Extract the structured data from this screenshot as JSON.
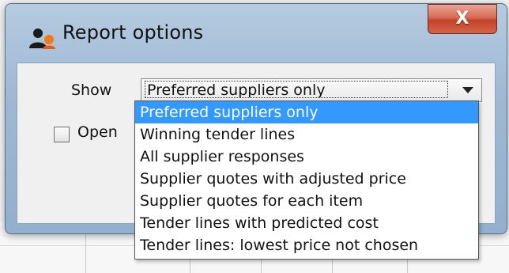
{
  "window": {
    "title": "Report options",
    "close_label": "X"
  },
  "form": {
    "show_label": "Show",
    "show_value": "Preferred suppliers only",
    "checkbox_label": "Open"
  },
  "dropdown": {
    "selected_index": 0,
    "options": [
      "Preferred suppliers only",
      "Winning tender lines",
      "All supplier responses",
      "Supplier quotes with adjusted price",
      "Supplier quotes for each item",
      "Tender lines with predicted cost",
      "Tender lines: lowest price not chosen"
    ]
  },
  "icons": {
    "title": "report-user-icon",
    "dropdown": "chevron-down-icon"
  },
  "colors": {
    "selection": "#3399ff",
    "close_button": "#c9503a",
    "frame": "#9fb9d4"
  }
}
